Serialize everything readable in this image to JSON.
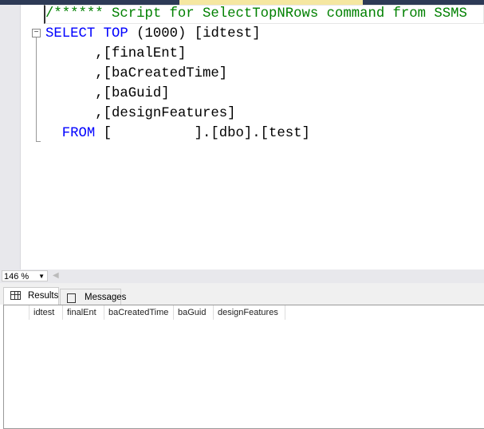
{
  "editor": {
    "lines": {
      "comment": "/****** Script for SelectTopNRows command from SSMS",
      "l1_kw1": "SELECT",
      "l1_kw2": "TOP",
      "l1_rest": " (1000) [idtest]",
      "l2": ",[finalEnt]",
      "l3": ",[baCreatedTime]",
      "l4": ",[baGuid]",
      "l5": ",[designFeatures]",
      "l6_kw": "FROM",
      "l6_rest": " [          ].[dbo].[test]"
    }
  },
  "zoom": {
    "value": "146 %"
  },
  "tabs": [
    {
      "label": "Results",
      "icon": "grid-icon"
    },
    {
      "label": "Messages",
      "icon": "messages-icon"
    }
  ],
  "results": {
    "columns": [
      "idtest",
      "finalEnt",
      "baCreatedTime",
      "baGuid",
      "designFeatures"
    ]
  }
}
